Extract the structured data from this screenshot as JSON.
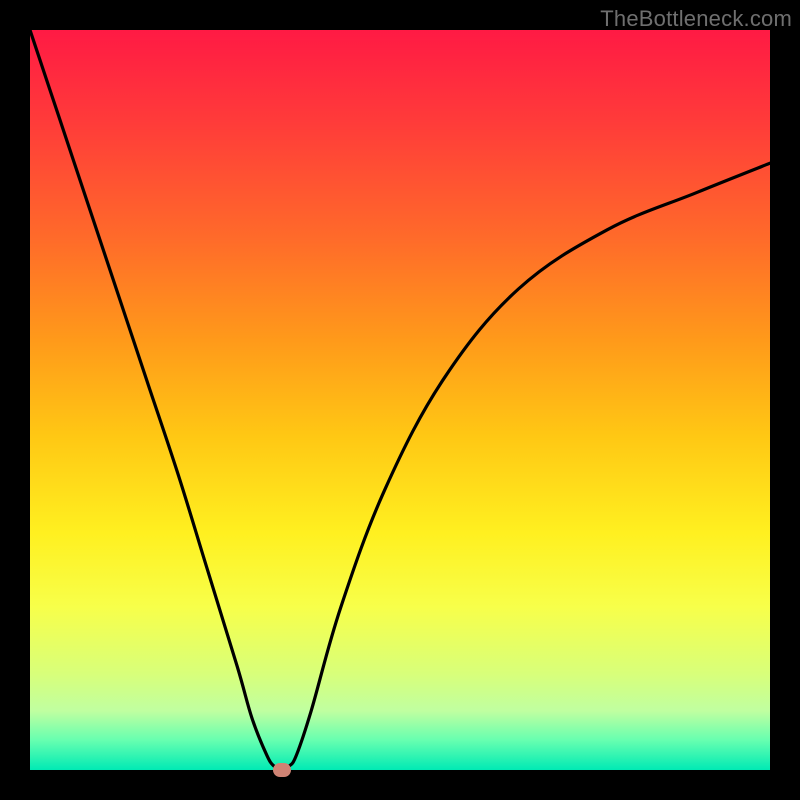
{
  "watermark": "TheBottleneck.com",
  "colors": {
    "frame": "#000000",
    "curve": "#000000",
    "marker": "#cf8374",
    "gradient_top": "#ff1a44",
    "gradient_bottom": "#00eab4"
  },
  "chart_data": {
    "type": "line",
    "title": "",
    "xlabel": "",
    "ylabel": "",
    "xlim": [
      0,
      100
    ],
    "ylim": [
      0,
      100
    ],
    "grid": false,
    "legend": false,
    "series": [
      {
        "name": "bottleneck-curve",
        "x": [
          0,
          4,
          8,
          12,
          16,
          20,
          24,
          28,
          30,
          32,
          33,
          34,
          35,
          36,
          38,
          42,
          48,
          56,
          66,
          78,
          90,
          100
        ],
        "y": [
          100,
          88,
          76,
          64,
          52,
          40,
          27,
          14,
          7,
          2,
          0.5,
          0,
          0.5,
          2,
          8,
          22,
          38,
          53,
          65,
          73,
          78,
          82
        ]
      }
    ],
    "marker": {
      "x": 34,
      "y": 0
    }
  }
}
